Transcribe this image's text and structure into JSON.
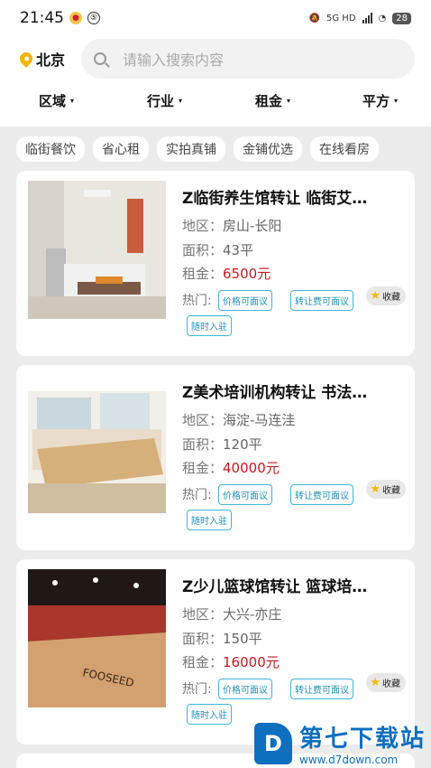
{
  "status": {
    "time": "21:45",
    "battery": "28",
    "net": "5G HD"
  },
  "header": {
    "city": "北京",
    "search_placeholder": "请输入搜索内容"
  },
  "filters": [
    {
      "label": "区域",
      "arrow": "▾"
    },
    {
      "label": "行业",
      "arrow": "▾"
    },
    {
      "label": "租金",
      "arrow": "▾"
    },
    {
      "label": "平方",
      "arrow": "▾"
    }
  ],
  "tags": [
    "临街餐饮",
    "省心租",
    "实拍真铺",
    "金铺优选",
    "在线看房"
  ],
  "listings": [
    {
      "title": "Z临街养生馆转让 临街艾…",
      "district_label": "地区：",
      "district": "房山-长阳",
      "area_label": "面积：",
      "area": "43平",
      "rent_label": "租金：",
      "rent": "6500元",
      "hot_label": "热门:",
      "chips": [
        "价格可面议",
        "转让费可面议",
        "随时入驻"
      ],
      "fav": "收藏"
    },
    {
      "title": "Z美术培训机构转让 书法…",
      "district_label": "地区：",
      "district": "海淀-马连洼",
      "area_label": "面积：",
      "area": "120平",
      "rent_label": "租金：",
      "rent": "40000元",
      "hot_label": "热门:",
      "chips": [
        "价格可面议",
        "转让费可面议",
        "随时入驻"
      ],
      "fav": "收藏"
    },
    {
      "title": "Z少儿篮球馆转让 篮球培…",
      "district_label": "地区：",
      "district": "大兴-亦庄",
      "area_label": "面积：",
      "area": "150平",
      "rent_label": "租金：",
      "rent": "16000元",
      "hot_label": "热门:",
      "chips": [
        "价格可面议",
        "转让费可面议",
        "随时入驻"
      ],
      "fav": "收藏"
    }
  ],
  "watermark": {
    "logo": "D",
    "title": "第七下载站",
    "url": "www.d7down.com"
  },
  "colors": {
    "accent": "#3fb6d8",
    "price": "#c9181e",
    "pin": "#f2b600"
  }
}
